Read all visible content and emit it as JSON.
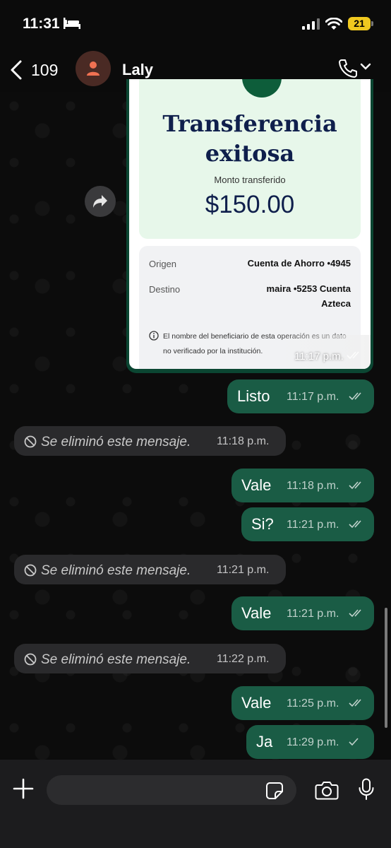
{
  "status_bar": {
    "time": "11:31",
    "battery": "21"
  },
  "header": {
    "back_count": "109",
    "contact_name": "Laly"
  },
  "receipt_card": {
    "title": "Transferencia exitosa",
    "subtitle": "Monto transferido",
    "amount": "$150.00",
    "origin_label": "Origen",
    "origin_value": "Cuenta de Ahorro •4945",
    "destination_label": "Destino",
    "destination_value": "maira •5253 Cuenta Azteca",
    "notice": "El nombre del beneficiario de esta operación es un dato no verificado por la institución.",
    "time": "11:17 p.m."
  },
  "messages": [
    {
      "type": "out",
      "text": "Listo",
      "time": "11:17 p.m.",
      "status": "read"
    },
    {
      "type": "deleted",
      "text": "Se eliminó este mensaje.",
      "time": "11:18 p.m."
    },
    {
      "type": "out",
      "text": "Vale",
      "time": "11:18 p.m.",
      "status": "read"
    },
    {
      "type": "out",
      "text": "Si?",
      "time": "11:21 p.m.",
      "status": "read"
    },
    {
      "type": "deleted",
      "text": "Se eliminó este mensaje.",
      "time": "11:21 p.m."
    },
    {
      "type": "out",
      "text": "Vale",
      "time": "11:21 p.m.",
      "status": "read"
    },
    {
      "type": "deleted",
      "text": "Se eliminó este mensaje.",
      "time": "11:22 p.m."
    },
    {
      "type": "out",
      "text": "Vale",
      "time": "11:25 p.m.",
      "status": "read"
    },
    {
      "type": "out",
      "text": "Ja",
      "time": "11:29 p.m.",
      "status": "sent"
    }
  ],
  "composer": {
    "placeholder": ""
  },
  "colors": {
    "outgoing_bubble": "#1a5c45",
    "incoming_bubble": "#2a2a2c",
    "battery": "#f0c91f"
  }
}
